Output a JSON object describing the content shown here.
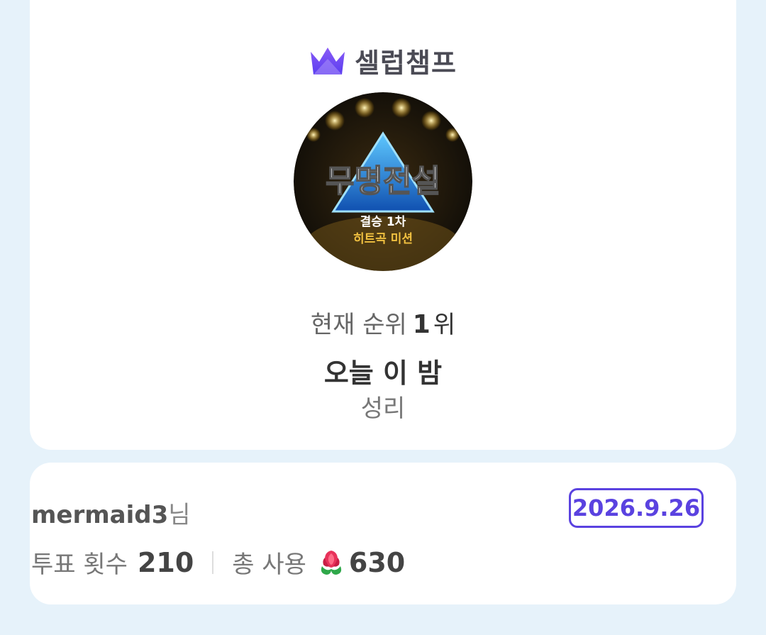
{
  "brand": {
    "name": "셀럽챔프",
    "logo_icon": "crown-icon",
    "accent": "#6b4cf0"
  },
  "poster": {
    "icon": "show-poster",
    "title_text": "무명전설",
    "subtitle_line1": "결승 1차",
    "subtitle_line2": "히트곡 미션"
  },
  "ranking": {
    "label": "현재 순위",
    "value": "1",
    "unit": "위"
  },
  "song": {
    "title": "오늘 이 밤",
    "artist": "성리"
  },
  "user": {
    "name": "mermaid3",
    "suffix": "님"
  },
  "date": "2026.9.26",
  "stats": {
    "votes_label": "투표 횟수",
    "votes_value": "210",
    "used_label": "총 사용",
    "used_icon": "flower-icon",
    "used_value": "630"
  }
}
